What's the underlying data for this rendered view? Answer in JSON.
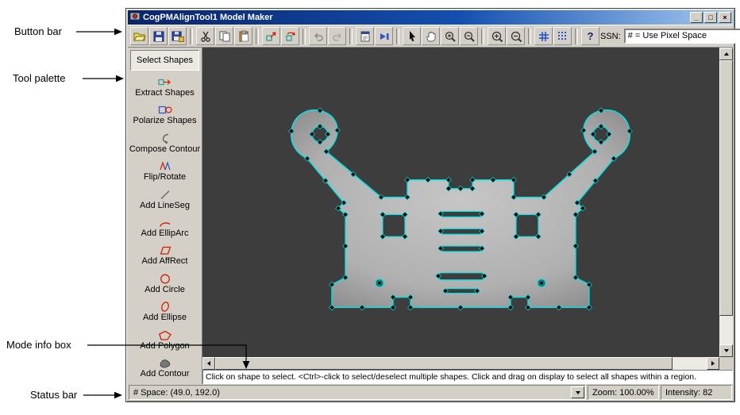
{
  "annotations": {
    "button_bar": "Button bar",
    "tool_palette": "Tool palette",
    "mode_info_box": "Mode info box",
    "status_bar": "Status bar"
  },
  "window": {
    "title": "CogPMAlignTool1 Model Maker",
    "controls": {
      "minimize": "_",
      "maximize": "□",
      "close": "×"
    },
    "toolbar": {
      "ssn_label": "SSN:",
      "ssn_value": "# = Use Pixel Space",
      "help_glyph": "?"
    },
    "palette": {
      "items": [
        {
          "label": "Select Shapes"
        },
        {
          "label": "Extract Shapes"
        },
        {
          "label": "Polarize Shapes"
        },
        {
          "label": "Compose Contour"
        },
        {
          "label": "Flip/Rotate"
        },
        {
          "label": "Add LineSeg"
        },
        {
          "label": "Add EllipArc"
        },
        {
          "label": "Add AffRect"
        },
        {
          "label": "Add Circle"
        },
        {
          "label": "Add Ellipse"
        },
        {
          "label": "Add Polygon"
        },
        {
          "label": "Add Contour"
        }
      ]
    },
    "mode_info": "Click on shape to select. <Ctrl>-click to select/deselect multiple shapes. Click and drag on display to select all shapes within a region.",
    "status": {
      "space": "# Space:  (49.0, 192.0)",
      "zoom": "Zoom:  100.00%",
      "intensity": "Intensity: 82"
    }
  }
}
